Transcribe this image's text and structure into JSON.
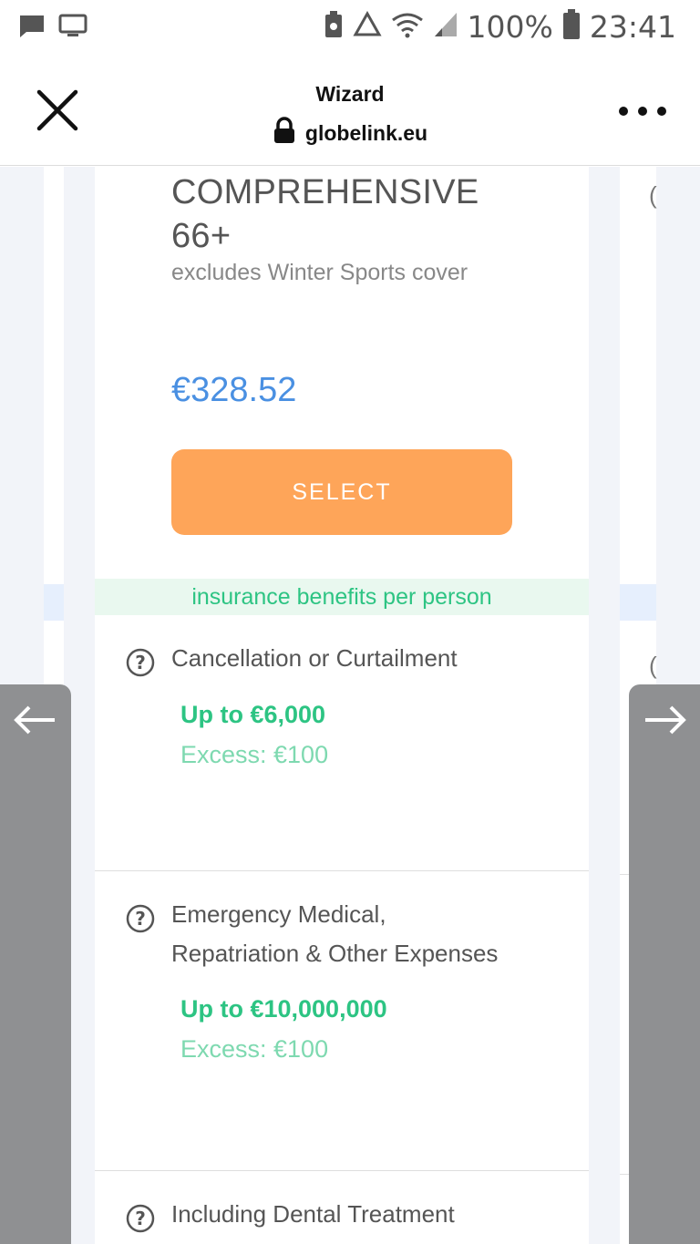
{
  "status_bar": {
    "battery_percent": "100%",
    "time": "23:41"
  },
  "header": {
    "title": "Wizard",
    "url": "globelink.eu"
  },
  "plan": {
    "name_line1": "COMPREHENSIVE",
    "name_line2": "66+",
    "note": "excludes Winter Sports cover",
    "price": "€328.52",
    "select_label": "SELECT",
    "benefits_header": "insurance benefits per person"
  },
  "benefits": [
    {
      "label": "Cancellation or Curtailment",
      "label_line2": "",
      "amount": "Up to €6,000",
      "excess": "Excess: €100"
    },
    {
      "label": "Emergency Medical,",
      "label_line2": "Repatriation & Other Expenses",
      "amount": "Up to €10,000,000",
      "excess": "Excess: €100"
    },
    {
      "label": "Including Dental Treatment",
      "label_line2": "",
      "amount": "",
      "excess": ""
    }
  ],
  "colors": {
    "accent_orange": "#fea559",
    "price_blue": "#4a90e2",
    "benefit_green": "#2dc483",
    "excess_green": "#7ed9b0"
  }
}
